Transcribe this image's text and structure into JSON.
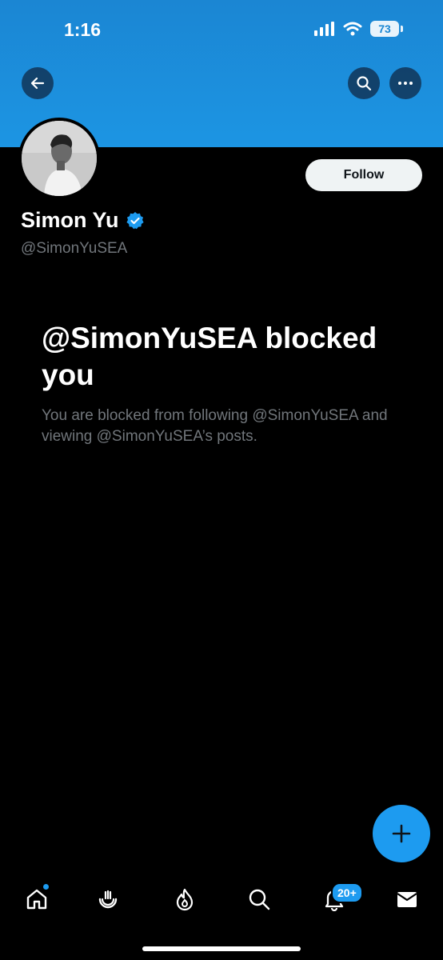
{
  "status_bar": {
    "time": "1:16",
    "battery": "73"
  },
  "profile": {
    "display_name": "Simon Yu",
    "handle": "@SimonYuSEA",
    "follow_label": "Follow"
  },
  "blocked": {
    "title": "@SimonYuSEA blocked you",
    "description": "You are blocked from following @SimonYuSEA and viewing @SimonYuSEA’s posts."
  },
  "bottom_nav": {
    "notifications_badge": "20+"
  },
  "colors": {
    "accent": "#1d9bf0",
    "banner": "#1c8fdc",
    "muted_text": "#71767b"
  },
  "icons": [
    "back-arrow-icon",
    "search-icon",
    "more-icon",
    "verified-badge-icon",
    "compose-plus-icon",
    "home-icon",
    "grok-icon",
    "spaces-flame-icon",
    "explore-search-icon",
    "notifications-bell-icon",
    "messages-envelope-icon"
  ]
}
